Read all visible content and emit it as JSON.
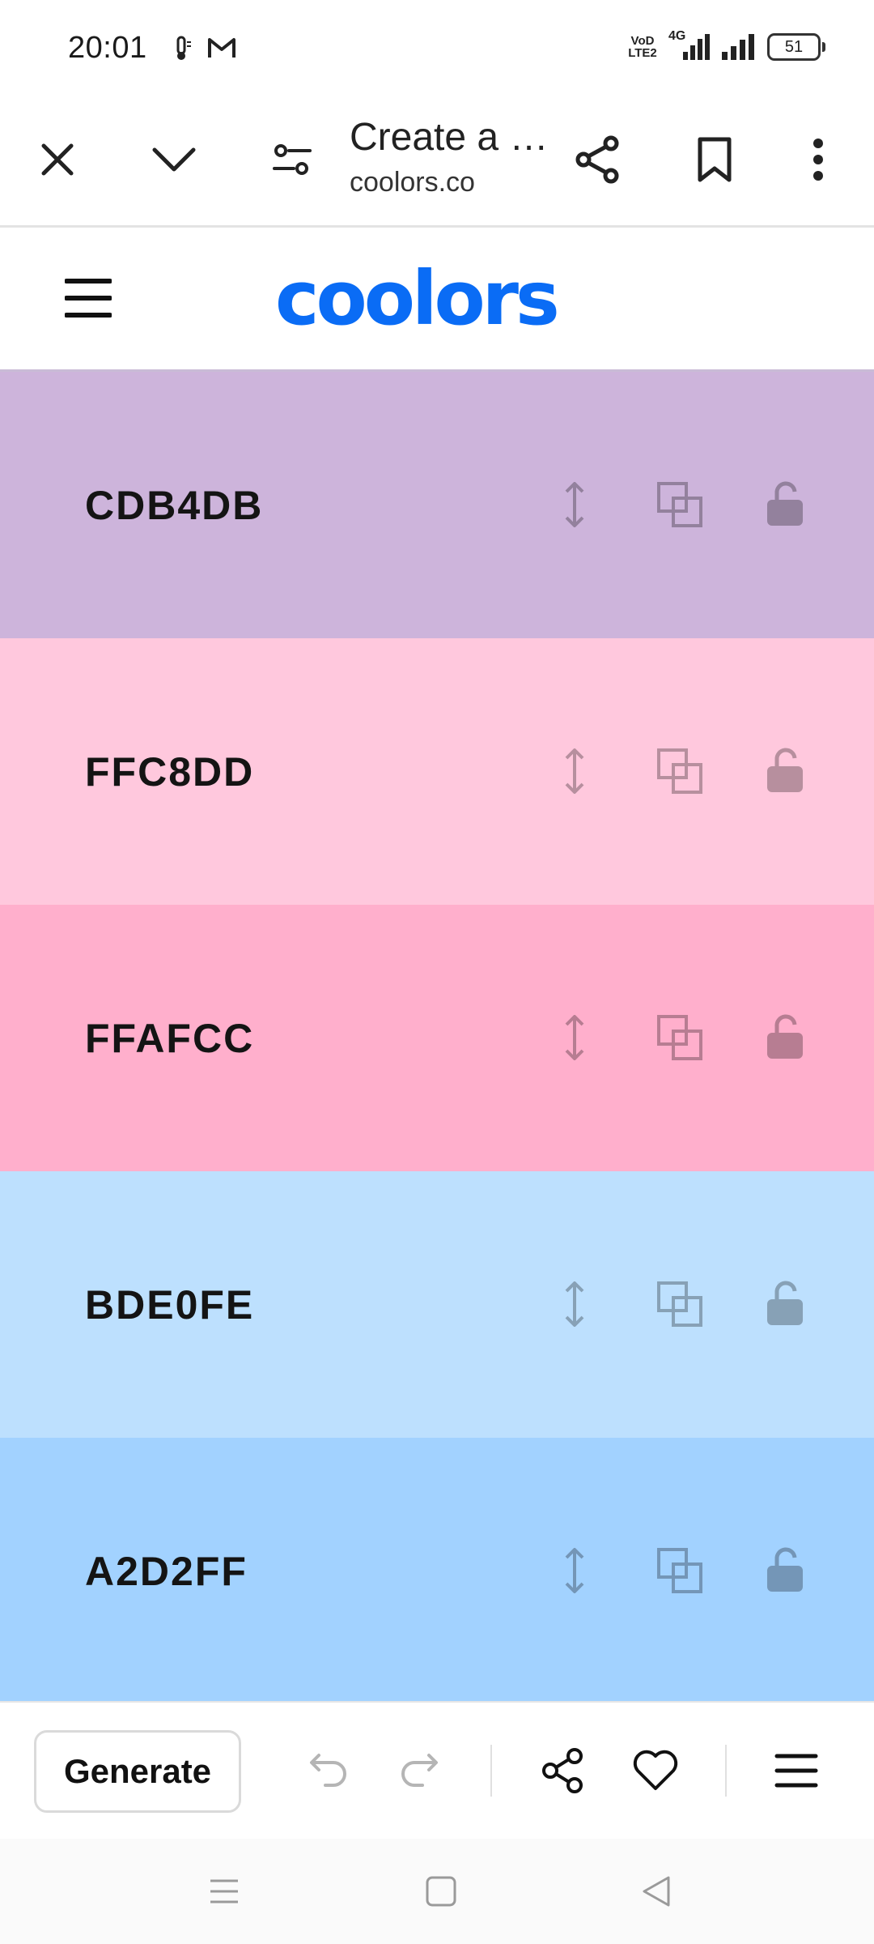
{
  "status": {
    "time": "20:01",
    "volte_line1": "VoD",
    "volte_line2": "LTE2",
    "network": "4G",
    "battery": "51"
  },
  "browser": {
    "title": "Create a …",
    "url": "coolors.co"
  },
  "site": {
    "logo": "coolors"
  },
  "palette": [
    {
      "hex": "CDB4DB",
      "color": "#CDB4DB"
    },
    {
      "hex": "FFC8DD",
      "color": "#FFC8DD"
    },
    {
      "hex": "FFAFCC",
      "color": "#FFAFCC"
    },
    {
      "hex": "BDE0FE",
      "color": "#BDE0FE"
    },
    {
      "hex": "A2D2FF",
      "color": "#A2D2FF"
    }
  ],
  "bottom": {
    "generate_label": "Generate"
  },
  "icons": {
    "close": "close-icon",
    "collapse": "chevron-down-icon",
    "page_settings": "tune-icon",
    "share": "share-icon",
    "bookmark": "bookmark-icon",
    "more": "more-vert-icon",
    "menu": "hamburger-icon",
    "drag": "drag-vertical-icon",
    "copy": "copy-icon",
    "lock": "lock-open-icon",
    "undo": "undo-icon",
    "redo": "redo-icon",
    "favorite": "heart-icon"
  },
  "colors": {
    "brand": "#0A6CF5"
  }
}
